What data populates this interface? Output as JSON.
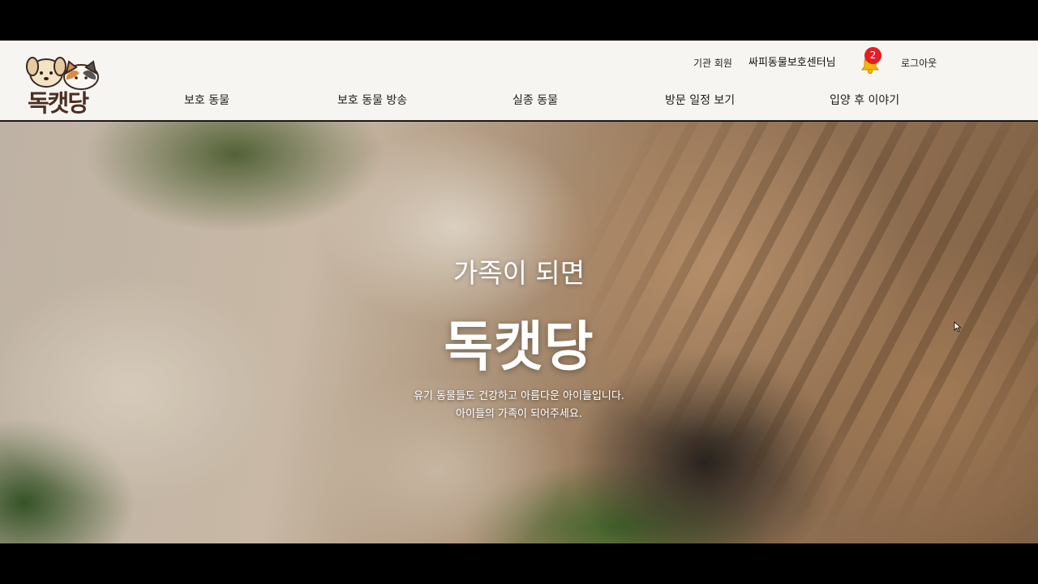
{
  "header": {
    "logo_text": "독캣당",
    "member_label": "기관 회원",
    "center_name": "싸피동물보호센터님",
    "notification_count": "2",
    "logout_label": "로그아웃",
    "nav": [
      {
        "label": "보호 동물"
      },
      {
        "label": "보호 동물 방송"
      },
      {
        "label": "실종 동물"
      },
      {
        "label": "방문 일정 보기"
      },
      {
        "label": "입양 후 이야기"
      }
    ]
  },
  "hero": {
    "subtitle": "가족이 되면",
    "title": "독캣당",
    "desc_line1": "유기 동물들도 건강하고 아름다운 아이들입니다.",
    "desc_line2": "아이들의 가족이 되어주세요."
  },
  "colors": {
    "header_bg": "#f7f5f1",
    "logo_brown": "#4b2e22",
    "badge_red": "#e31e24",
    "bell_yellow": "#f2b705"
  },
  "icons": {
    "logo": "dog-cat-logo-icon",
    "bell": "bell-icon",
    "cursor": "mouse-cursor-icon"
  }
}
